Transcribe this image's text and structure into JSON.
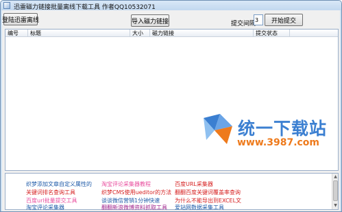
{
  "window": {
    "title": "迅雷磁力链接批量离线下载工具 作者QQ10532071"
  },
  "toolbar": {
    "login_label": "登陆迅雷离线",
    "import_label": "导入磁力链接",
    "interval_label": "提交间隔",
    "interval_value": "3",
    "start_label": "开始提交"
  },
  "list": {
    "columns": [
      "编号",
      "标题",
      "大小",
      "磁力链接",
      "提交状态"
    ],
    "rows": []
  },
  "watermark": {
    "brand": "统一下载站",
    "url": "www.3987.com"
  },
  "links": [
    {
      "text": "织梦添加文章自定义属性的",
      "color": "blue"
    },
    {
      "text": "淘宝评论采集器教程",
      "color": "pink"
    },
    {
      "text": "百度URL采集器",
      "color": "red"
    },
    {
      "text": "关键词排名查询工具",
      "color": "red"
    },
    {
      "text": "织梦CMS使用ueditor的方法",
      "color": "red"
    },
    {
      "text": "翻翻百度关键词覆盖率查询",
      "color": "red"
    },
    {
      "text": "百度url批量提交工具",
      "color": "pink"
    },
    {
      "text": "谈谈微信营销1分钟快速",
      "color": "blue"
    },
    {
      "text": "为什么不能导出到EXCEL文",
      "color": "red"
    },
    {
      "text": "淘宝评论采集器",
      "color": "blue"
    },
    {
      "text": "翻翻新浪微博资料抓取工具",
      "color": "purple"
    },
    {
      "text": "爱站网数据采集工具",
      "color": "blue"
    }
  ]
}
